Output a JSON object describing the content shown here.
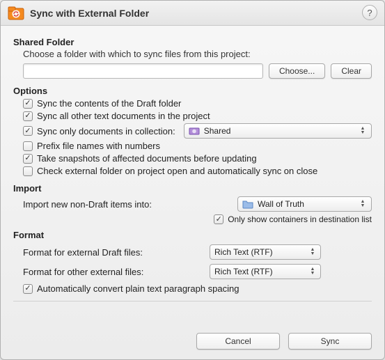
{
  "window": {
    "title": "Sync with External Folder"
  },
  "shared": {
    "heading": "Shared Folder",
    "hint": "Choose a folder with which to sync files from this project:",
    "path": "",
    "choose": "Choose...",
    "clear": "Clear"
  },
  "options": {
    "heading": "Options",
    "sync_draft": "Sync the contents of the Draft folder",
    "sync_other": "Sync all other text documents in the project",
    "sync_collection_label": "Sync only documents in collection:",
    "collection_value": "Shared",
    "prefix": "Prefix file names with numbers",
    "snapshots": "Take snapshots of affected documents before updating",
    "auto_sync": "Check external folder on project open and automatically sync on close"
  },
  "import": {
    "heading": "Import",
    "target_label": "Import new non-Draft items into:",
    "target_value": "Wall of Truth",
    "only_containers": "Only show containers in destination list"
  },
  "format": {
    "heading": "Format",
    "draft_label": "Format for external Draft files:",
    "other_label": "Format for other external files:",
    "draft_value": "Rich Text (RTF)",
    "other_value": "Rich Text (RTF)",
    "auto_convert": "Automatically convert plain text paragraph spacing"
  },
  "footer": {
    "cancel": "Cancel",
    "sync": "Sync"
  }
}
